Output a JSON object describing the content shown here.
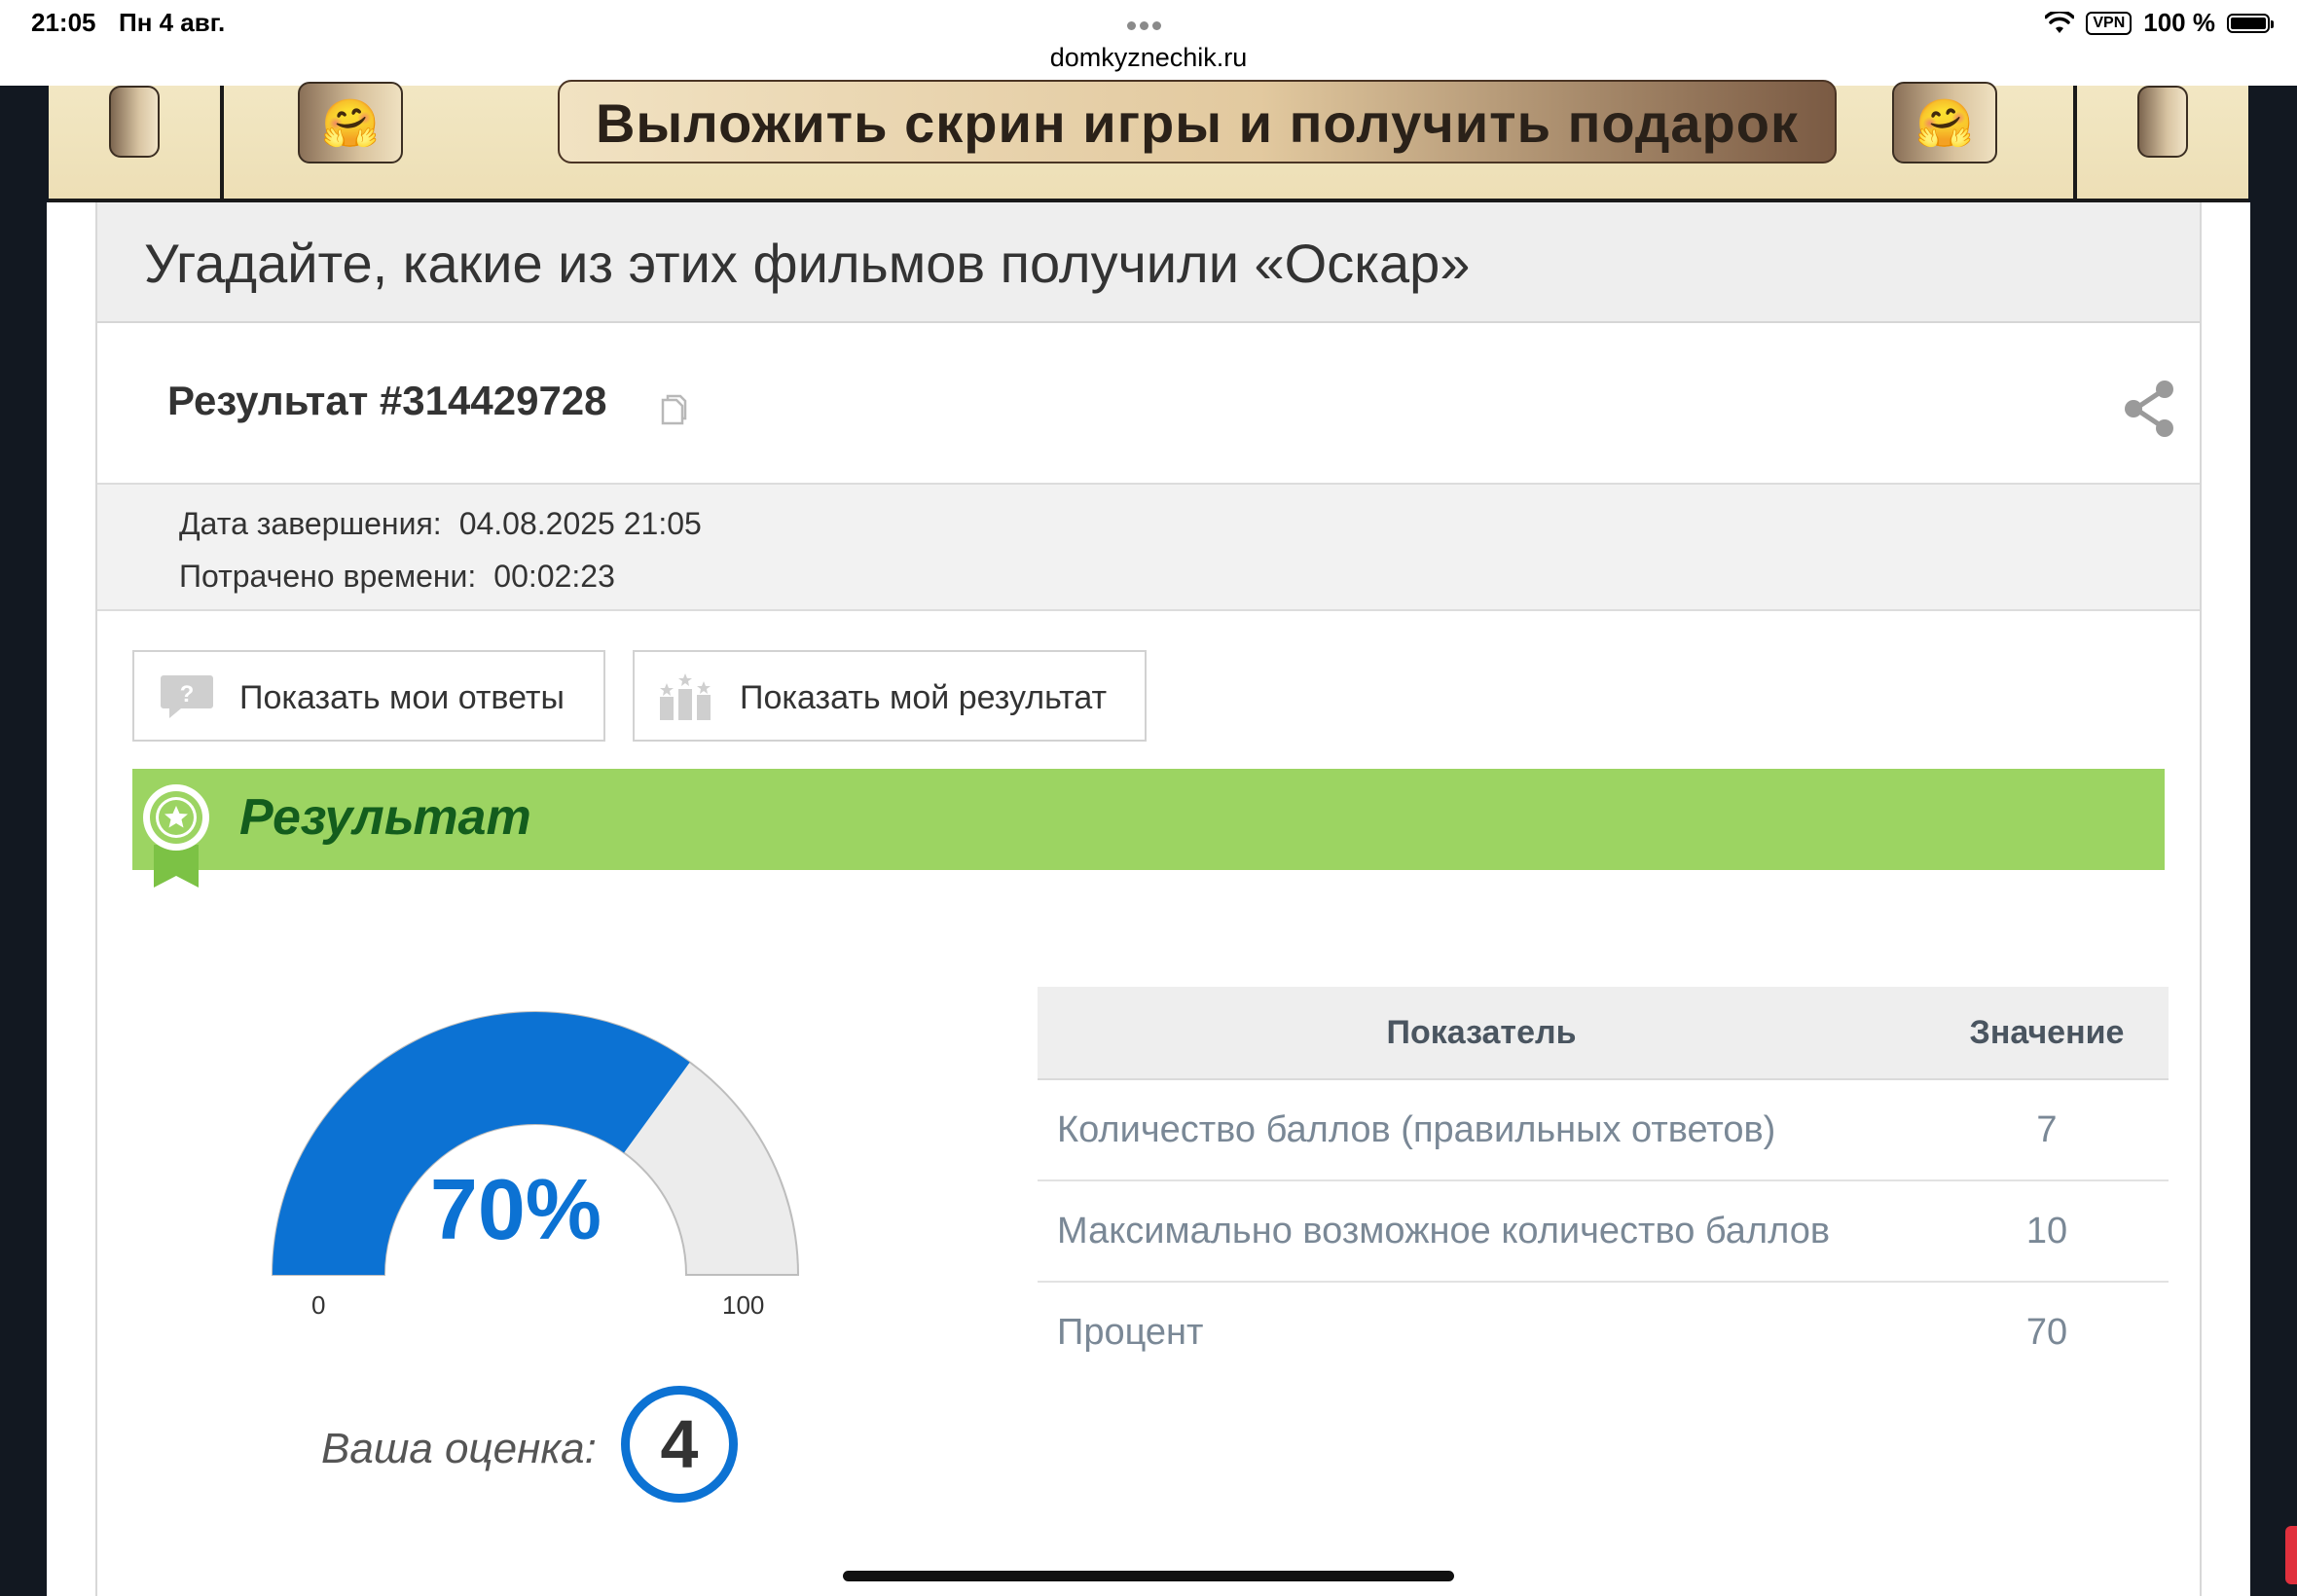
{
  "status_bar": {
    "time": "21:05",
    "date": "Пн 4 авг.",
    "url": "domkyznechik.ru",
    "vpn": "VPN",
    "battery": "100 %"
  },
  "banner": {
    "text": "Выложить скрин игры и получить подарок",
    "emoji": "🤗"
  },
  "page": {
    "title": "Угадайте, какие из этих фильмов получили «Оскар»",
    "result_id": "Результат #314429728",
    "completion_label": "Дата завершения:",
    "completion_value": "04.08.2025 21:05",
    "time_spent_label": "Потрачено времени:",
    "time_spent_value": "00:02:23"
  },
  "buttons": {
    "show_answers": "Показать мои ответы",
    "show_result": "Показать мой результат"
  },
  "result_section": {
    "title": "Результат",
    "gauge": {
      "percent_label": "70%",
      "value": 70,
      "min": "0",
      "max": "100"
    },
    "grade_label": "Ваша оценка:",
    "grade_value": "4"
  },
  "table": {
    "headers": [
      "Показатель",
      "Значение"
    ],
    "rows": [
      {
        "label": "Количество баллов (правильных ответов)",
        "value": "7"
      },
      {
        "label": "Максимально возможное количество баллов",
        "value": "10"
      },
      {
        "label": "Процент",
        "value": "70"
      }
    ]
  },
  "colors": {
    "accent_blue": "#0c72d3",
    "green_bar": "#9cd462",
    "green_title": "#135d1d"
  }
}
